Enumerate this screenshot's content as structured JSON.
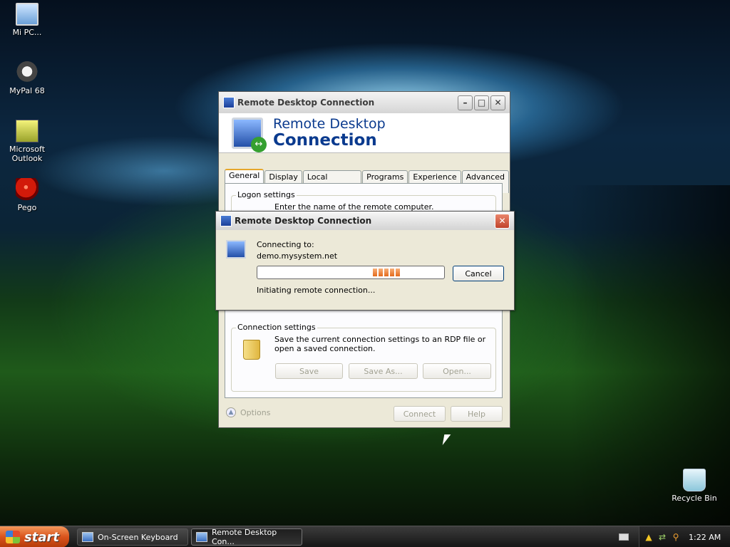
{
  "desktop": {
    "icons": [
      {
        "label": "Mi PC...",
        "icon": "computer-icon"
      },
      {
        "label": "MyPal 68",
        "icon": "mypal-browser-icon"
      },
      {
        "label": "Microsoft Outlook",
        "icon": "outlook-icon"
      },
      {
        "label": "Pego",
        "icon": "pego-icon"
      },
      {
        "label": "Recycle Bin",
        "icon": "recycle-bin-icon"
      }
    ]
  },
  "rdc_window": {
    "title": "Remote Desktop Connection",
    "banner_line1": "Remote Desktop",
    "banner_line2": "Connection",
    "tabs": [
      "General",
      "Display",
      "Local Resources",
      "Programs",
      "Experience",
      "Advanced"
    ],
    "active_tab": "General",
    "logon_group": {
      "label": "Logon settings",
      "text": "Enter the name of the remote computer."
    },
    "connection_group": {
      "label": "Connection settings",
      "text": "Save the current connection settings to an RDP file or open a saved connection.",
      "save_label": "Save",
      "save_as_label": "Save As...",
      "open_label": "Open..."
    },
    "options_label": "Options",
    "connect_label": "Connect",
    "help_label": "Help"
  },
  "progress_dialog": {
    "title": "Remote Desktop Connection",
    "connecting_label": "Connecting to:",
    "host": "demo.mysystem.net",
    "cancel_label": "Cancel",
    "status": "Initiating remote connection..."
  },
  "taskbar": {
    "start_label": "start",
    "tasks": [
      {
        "label": "On-Screen Keyboard"
      },
      {
        "label": "Remote Desktop Con..."
      }
    ],
    "clock": "1:22 AM"
  }
}
